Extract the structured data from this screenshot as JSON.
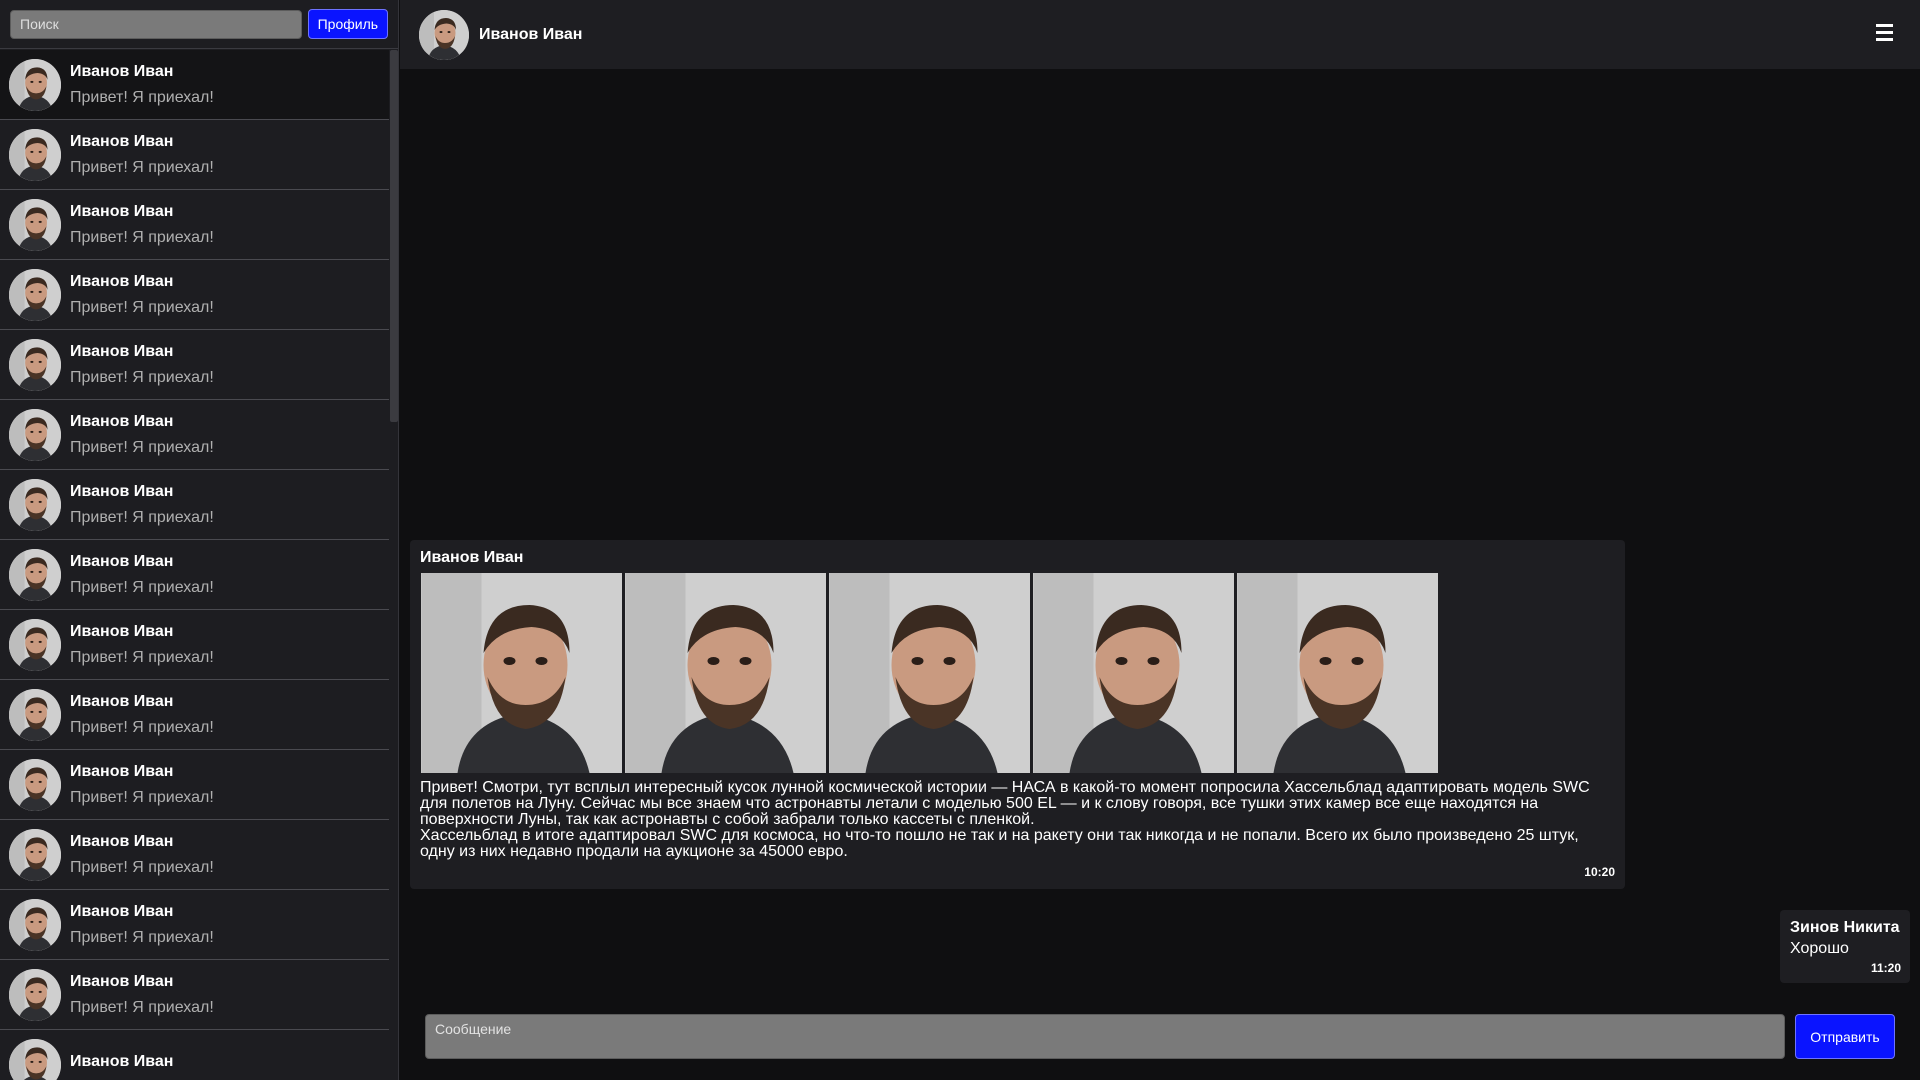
{
  "search": {
    "placeholder": "Поиск"
  },
  "sidebar": {
    "profile_label": "Профиль",
    "chats": [
      {
        "name": "Иванов Иван",
        "preview": "Привет! Я приехал!"
      },
      {
        "name": "Иванов Иван",
        "preview": "Привет! Я приехал!"
      },
      {
        "name": "Иванов Иван",
        "preview": "Привет! Я приехал!"
      },
      {
        "name": "Иванов Иван",
        "preview": "Привет! Я приехал!"
      },
      {
        "name": "Иванов Иван",
        "preview": "Привет! Я приехал!"
      },
      {
        "name": "Иванов Иван",
        "preview": "Привет! Я приехал!"
      },
      {
        "name": "Иванов Иван",
        "preview": "Привет! Я приехал!"
      },
      {
        "name": "Иванов Иван",
        "preview": "Привет! Я приехал!"
      },
      {
        "name": "Иванов Иван",
        "preview": "Привет! Я приехал!"
      },
      {
        "name": "Иванов Иван",
        "preview": "Привет! Я приехал!"
      },
      {
        "name": "Иванов Иван",
        "preview": "Привет! Я приехал!"
      },
      {
        "name": "Иванов Иван",
        "preview": "Привет! Я приехал!"
      },
      {
        "name": "Иванов Иван",
        "preview": "Привет! Я приехал!"
      },
      {
        "name": "Иванов Иван",
        "preview": "Привет! Я приехал!"
      },
      {
        "name": "Иванов Иван",
        "preview": ""
      }
    ]
  },
  "header": {
    "name": "Иванов Иван"
  },
  "messages": {
    "incoming": {
      "author": "Иванов Иван",
      "photo_count": 5,
      "text_1": "Привет! Смотри, тут всплыл интересный кусок лунной космической истории — НАСА в какой-то момент попросила Хассельблад адаптировать модель SWC для полетов на Луну. Сейчас мы все знаем что астронавты летали с моделью 500 EL — и к слову говоря, все тушки этих камер все еще находятся на поверхности Луны, так как астронавты с собой забрали только кассеты с пленкой.",
      "text_2": "Хассельблад в итоге адаптировал SWC для космоса, но что-то пошло не так и на ракету они так никогда и не попали. Всего их было произведено 25 штук, одну из них недавно продали на аукционе за 45000 евро.",
      "time": "10:20"
    },
    "outgoing": {
      "author": "Зинов Никита",
      "text": "Хорошо",
      "time": "11:20"
    }
  },
  "composer": {
    "placeholder": "Сообщение",
    "send_label": "Отправить"
  },
  "colors": {
    "accent": "#0a14ff",
    "sidebar_bg": "#1d1d21",
    "chat_bg": "#0f0f11",
    "bubble_bg": "#1e1e22",
    "input_bg": "#7a7a7a"
  }
}
